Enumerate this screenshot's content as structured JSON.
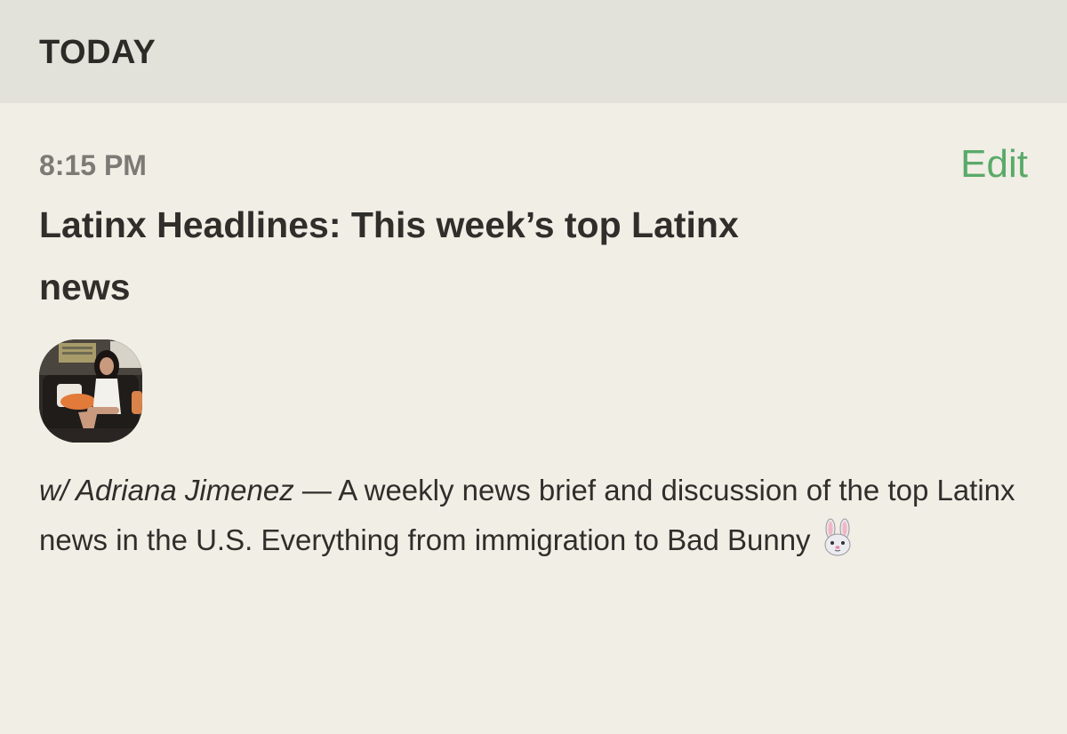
{
  "section": {
    "title": "TODAY"
  },
  "event": {
    "time": "8:15 PM",
    "edit_label": "Edit",
    "title": "Latinx Headlines: This week’s top Latinx news",
    "host_prefix": "w/ Adriana Jimenez",
    "description": " — A weekly news brief and discussion of the top Latinx news in the U.S. Everything from immigration to Bad Bunny",
    "description_icon": "rabbit-face-icon"
  },
  "colors": {
    "background": "#f1eee5",
    "header_background": "#e3e2da",
    "accent": "#5aaa6a",
    "muted_text": "#7c7a75"
  }
}
